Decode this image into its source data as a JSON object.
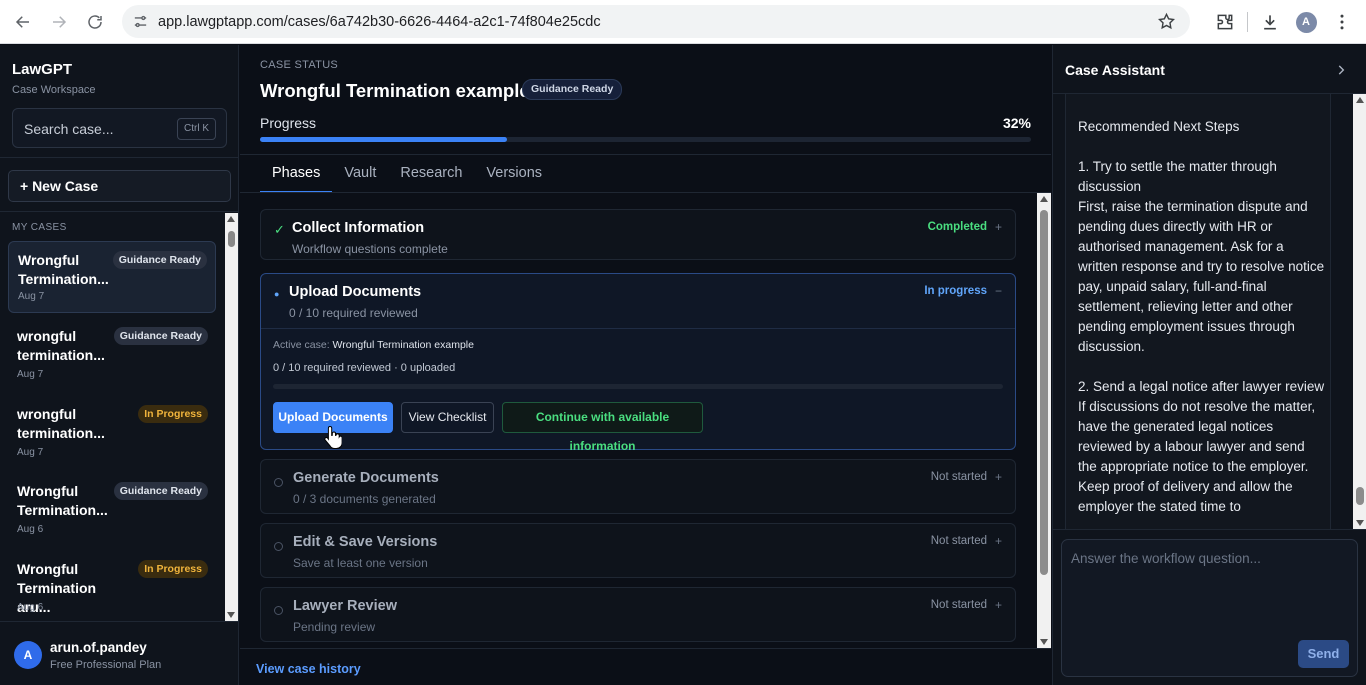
{
  "browser": {
    "url": "app.lawgptapp.com/cases/6a742b30-6626-4464-a2c1-74f804e25cdc",
    "profile_initial": "A"
  },
  "sidebar": {
    "brand": "LawGPT",
    "brand_sub": "Case Workspace",
    "search_placeholder": "Search case...",
    "search_shortcut": "Ctrl K",
    "new_case": "+ New Case",
    "section_label": "MY CASES",
    "cases": [
      {
        "title": "Wrongful Termination...",
        "date": "Aug 7",
        "badge": "Guidance Ready",
        "badge_type": "ready",
        "active": true
      },
      {
        "title": "wrongful termination...",
        "date": "Aug 7",
        "badge": "Guidance Ready",
        "badge_type": "ready",
        "active": false
      },
      {
        "title": "wrongful termination...",
        "date": "Aug 7",
        "badge": "In Progress",
        "badge_type": "progress",
        "active": false
      },
      {
        "title": "Wrongful Termination...",
        "date": "Aug 6",
        "badge": "Guidance Ready",
        "badge_type": "ready",
        "active": false
      },
      {
        "title": "Wrongful Termination aru...",
        "date": "Aug 6",
        "badge": "In Progress",
        "badge_type": "progress",
        "active": false
      }
    ],
    "user": {
      "initial": "A",
      "name": "arun.of.pandey",
      "plan": "Free Professional Plan"
    }
  },
  "main": {
    "status_label": "CASE STATUS",
    "title": "Wrongful Termination example",
    "status_badge": "Guidance Ready",
    "progress_label": "Progress",
    "progress_text": "32%",
    "progress_value": 0.32,
    "tabs": [
      "Phases",
      "Vault",
      "Research",
      "Versions"
    ],
    "active_tab": 0,
    "phases": [
      {
        "icon": "✓",
        "title": "Collect Information",
        "sub": "Workflow questions complete",
        "status": "Completed",
        "toggle": "+"
      },
      {
        "icon": "●",
        "title": "Upload Documents",
        "sub": "0 / 10 required reviewed",
        "status": "In progress",
        "toggle": "−",
        "active_case_label": "Active case:",
        "active_case": "Wrongful Termination example",
        "counts": "0 / 10 required reviewed · 0 uploaded",
        "buttons": {
          "upload": "Upload Documents",
          "checklist": "View Checklist",
          "continue": "Continue with available information"
        }
      },
      {
        "title": "Generate Documents",
        "sub": "0 / 3 documents generated",
        "status": "Not started",
        "toggle": "+"
      },
      {
        "title": "Edit & Save Versions",
        "sub": "Save at least one version",
        "status": "Not started",
        "toggle": "+"
      },
      {
        "title": "Lawyer Review",
        "sub": "Pending review",
        "status": "Not started",
        "toggle": "+"
      }
    ],
    "history_link": "View case history"
  },
  "assistant": {
    "title": "Case Assistant",
    "message": "Recommended Next Steps\n\n1. Try to settle the matter through discussion\nFirst, raise the termination dispute and pending dues directly with HR or authorised management. Ask for a written response and try to resolve notice pay, unpaid salary, full-and-final settlement, relieving letter and other pending employment issues through discussion.\n\n2. Send a legal notice after lawyer review\nIf discussions do not resolve the matter, have the generated legal notices reviewed by a labour lawyer and send the appropriate notice to the employer. Keep proof of delivery and allow the employer the stated time to",
    "input_placeholder": "Answer the workflow question...",
    "send": "Send"
  },
  "colors": {
    "accent": "#3b82f6",
    "completed": "#4ade80",
    "in_progress": "#60a5fa",
    "warning": "#f0b43c"
  }
}
